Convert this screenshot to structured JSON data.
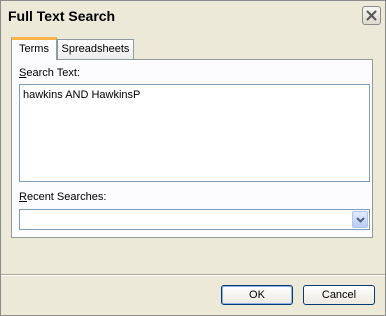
{
  "window": {
    "title": "Full Text Search"
  },
  "tabs": [
    {
      "label": "Terms",
      "active": true
    },
    {
      "label": "Spreadsheets",
      "active": false
    }
  ],
  "search": {
    "label_accel": "S",
    "label_rest": "earch Text:",
    "value": "hawkins AND HawkinsP"
  },
  "recent": {
    "label_accel": "R",
    "label_rest": "ecent Searches:",
    "selected": ""
  },
  "buttons": {
    "ok": "OK",
    "cancel": "Cancel"
  },
  "icons": {
    "close": "close-icon",
    "dropdown": "chevron-down-icon"
  },
  "colors": {
    "face": "#ece9d8",
    "active_tab_accent": "#f9b44c",
    "field_border": "#7f9db9"
  }
}
